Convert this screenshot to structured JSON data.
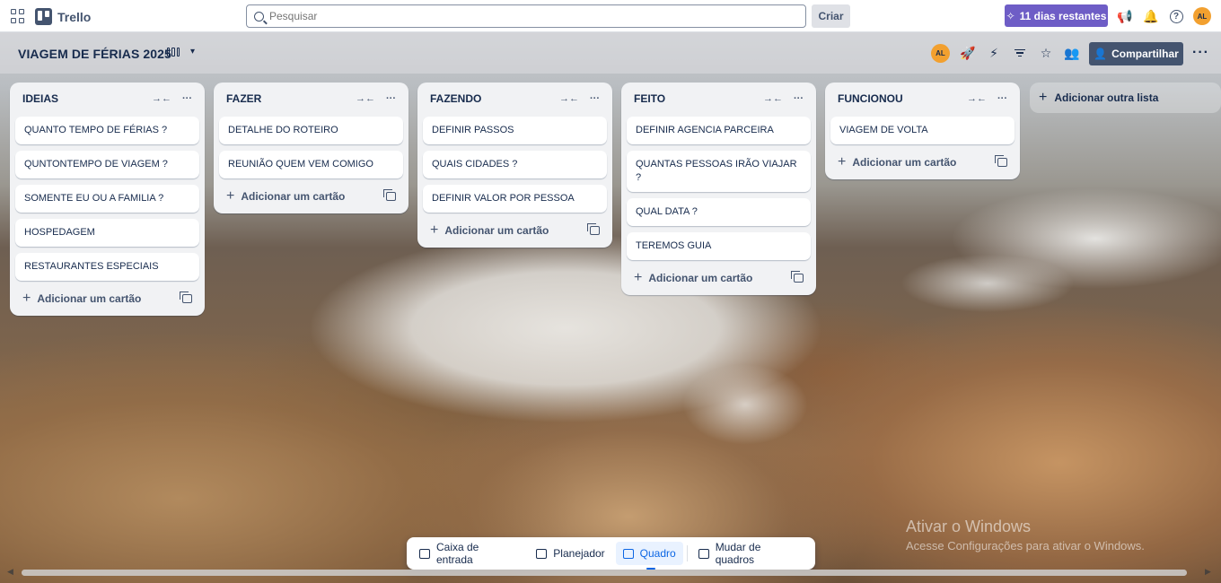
{
  "topbar": {
    "app_name": "Trello",
    "search_placeholder": "Pesquisar",
    "create_label": "Criar",
    "trial_label": "11 dias restantes",
    "avatar_initials": "AL"
  },
  "board": {
    "title": "VIAGEM DE FÉRIAS 2025",
    "avatar_initials": "AL",
    "share_label": "Compartilhar",
    "add_list_label": "Adicionar outra lista",
    "add_card_label": "Adicionar um cartão",
    "lists": [
      {
        "title": "IDEIAS",
        "cards": [
          "QUANTO TEMPO DE FÉRIAS ?",
          "QUNTONTEMPO DE VIAGEM ?",
          "SOMENTE EU OU A FAMILIA ?",
          "HOSPEDAGEM",
          "RESTAURANTES ESPECIAIS"
        ]
      },
      {
        "title": "FAZER",
        "cards": [
          "DETALHE DO ROTEIRO",
          "REUNIÃO QUEM VEM COMIGO"
        ]
      },
      {
        "title": "FAZENDO",
        "cards": [
          "DEFINIR PASSOS",
          "QUAIS CIDADES ?",
          "DEFINIR VALOR POR PESSOA"
        ]
      },
      {
        "title": "FEITO",
        "cards": [
          "DEFINIR AGENCIA PARCEIRA",
          "QUANTAS PESSOAS IRÃO VIAJAR ?",
          "QUAL DATA ?",
          "TEREMOS GUIA"
        ]
      },
      {
        "title": "FUNCIONOU",
        "cards": [
          "VIAGEM DE VOLTA"
        ]
      }
    ]
  },
  "switcher": {
    "inbox": "Caixa de entrada",
    "planner": "Planejador",
    "board": "Quadro",
    "switch_boards": "Mudar de quadros"
  },
  "watermark": {
    "line1": "Ativar o Windows",
    "line2": "Acesse Configurações para ativar o Windows."
  },
  "colors": {
    "accent": "#0c66e4",
    "trial": "#6e5dc6",
    "avatar": "#f2a02f",
    "list_bg": "#f1f2f4"
  }
}
